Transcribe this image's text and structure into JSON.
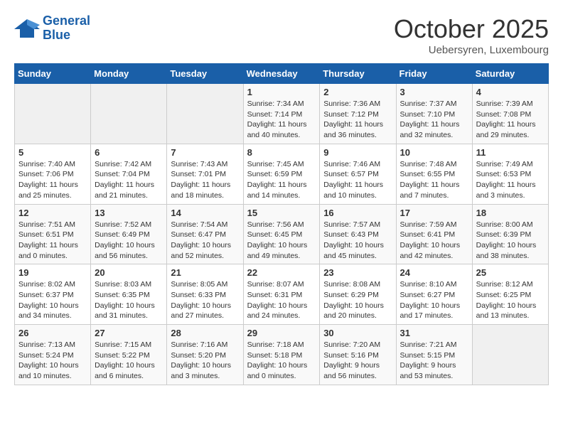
{
  "logo": {
    "line1": "General",
    "line2": "Blue"
  },
  "title": "October 2025",
  "location": "Uebersyren, Luxembourg",
  "days_header": [
    "Sunday",
    "Monday",
    "Tuesday",
    "Wednesday",
    "Thursday",
    "Friday",
    "Saturday"
  ],
  "weeks": [
    [
      {
        "num": "",
        "info": ""
      },
      {
        "num": "",
        "info": ""
      },
      {
        "num": "",
        "info": ""
      },
      {
        "num": "1",
        "info": "Sunrise: 7:34 AM\nSunset: 7:14 PM\nDaylight: 11 hours\nand 40 minutes."
      },
      {
        "num": "2",
        "info": "Sunrise: 7:36 AM\nSunset: 7:12 PM\nDaylight: 11 hours\nand 36 minutes."
      },
      {
        "num": "3",
        "info": "Sunrise: 7:37 AM\nSunset: 7:10 PM\nDaylight: 11 hours\nand 32 minutes."
      },
      {
        "num": "4",
        "info": "Sunrise: 7:39 AM\nSunset: 7:08 PM\nDaylight: 11 hours\nand 29 minutes."
      }
    ],
    [
      {
        "num": "5",
        "info": "Sunrise: 7:40 AM\nSunset: 7:06 PM\nDaylight: 11 hours\nand 25 minutes."
      },
      {
        "num": "6",
        "info": "Sunrise: 7:42 AM\nSunset: 7:04 PM\nDaylight: 11 hours\nand 21 minutes."
      },
      {
        "num": "7",
        "info": "Sunrise: 7:43 AM\nSunset: 7:01 PM\nDaylight: 11 hours\nand 18 minutes."
      },
      {
        "num": "8",
        "info": "Sunrise: 7:45 AM\nSunset: 6:59 PM\nDaylight: 11 hours\nand 14 minutes."
      },
      {
        "num": "9",
        "info": "Sunrise: 7:46 AM\nSunset: 6:57 PM\nDaylight: 11 hours\nand 10 minutes."
      },
      {
        "num": "10",
        "info": "Sunrise: 7:48 AM\nSunset: 6:55 PM\nDaylight: 11 hours\nand 7 minutes."
      },
      {
        "num": "11",
        "info": "Sunrise: 7:49 AM\nSunset: 6:53 PM\nDaylight: 11 hours\nand 3 minutes."
      }
    ],
    [
      {
        "num": "12",
        "info": "Sunrise: 7:51 AM\nSunset: 6:51 PM\nDaylight: 11 hours\nand 0 minutes."
      },
      {
        "num": "13",
        "info": "Sunrise: 7:52 AM\nSunset: 6:49 PM\nDaylight: 10 hours\nand 56 minutes."
      },
      {
        "num": "14",
        "info": "Sunrise: 7:54 AM\nSunset: 6:47 PM\nDaylight: 10 hours\nand 52 minutes."
      },
      {
        "num": "15",
        "info": "Sunrise: 7:56 AM\nSunset: 6:45 PM\nDaylight: 10 hours\nand 49 minutes."
      },
      {
        "num": "16",
        "info": "Sunrise: 7:57 AM\nSunset: 6:43 PM\nDaylight: 10 hours\nand 45 minutes."
      },
      {
        "num": "17",
        "info": "Sunrise: 7:59 AM\nSunset: 6:41 PM\nDaylight: 10 hours\nand 42 minutes."
      },
      {
        "num": "18",
        "info": "Sunrise: 8:00 AM\nSunset: 6:39 PM\nDaylight: 10 hours\nand 38 minutes."
      }
    ],
    [
      {
        "num": "19",
        "info": "Sunrise: 8:02 AM\nSunset: 6:37 PM\nDaylight: 10 hours\nand 34 minutes."
      },
      {
        "num": "20",
        "info": "Sunrise: 8:03 AM\nSunset: 6:35 PM\nDaylight: 10 hours\nand 31 minutes."
      },
      {
        "num": "21",
        "info": "Sunrise: 8:05 AM\nSunset: 6:33 PM\nDaylight: 10 hours\nand 27 minutes."
      },
      {
        "num": "22",
        "info": "Sunrise: 8:07 AM\nSunset: 6:31 PM\nDaylight: 10 hours\nand 24 minutes."
      },
      {
        "num": "23",
        "info": "Sunrise: 8:08 AM\nSunset: 6:29 PM\nDaylight: 10 hours\nand 20 minutes."
      },
      {
        "num": "24",
        "info": "Sunrise: 8:10 AM\nSunset: 6:27 PM\nDaylight: 10 hours\nand 17 minutes."
      },
      {
        "num": "25",
        "info": "Sunrise: 8:12 AM\nSunset: 6:25 PM\nDaylight: 10 hours\nand 13 minutes."
      }
    ],
    [
      {
        "num": "26",
        "info": "Sunrise: 7:13 AM\nSunset: 5:24 PM\nDaylight: 10 hours\nand 10 minutes."
      },
      {
        "num": "27",
        "info": "Sunrise: 7:15 AM\nSunset: 5:22 PM\nDaylight: 10 hours\nand 6 minutes."
      },
      {
        "num": "28",
        "info": "Sunrise: 7:16 AM\nSunset: 5:20 PM\nDaylight: 10 hours\nand 3 minutes."
      },
      {
        "num": "29",
        "info": "Sunrise: 7:18 AM\nSunset: 5:18 PM\nDaylight: 10 hours\nand 0 minutes."
      },
      {
        "num": "30",
        "info": "Sunrise: 7:20 AM\nSunset: 5:16 PM\nDaylight: 9 hours\nand 56 minutes."
      },
      {
        "num": "31",
        "info": "Sunrise: 7:21 AM\nSunset: 5:15 PM\nDaylight: 9 hours\nand 53 minutes."
      },
      {
        "num": "",
        "info": ""
      }
    ]
  ]
}
